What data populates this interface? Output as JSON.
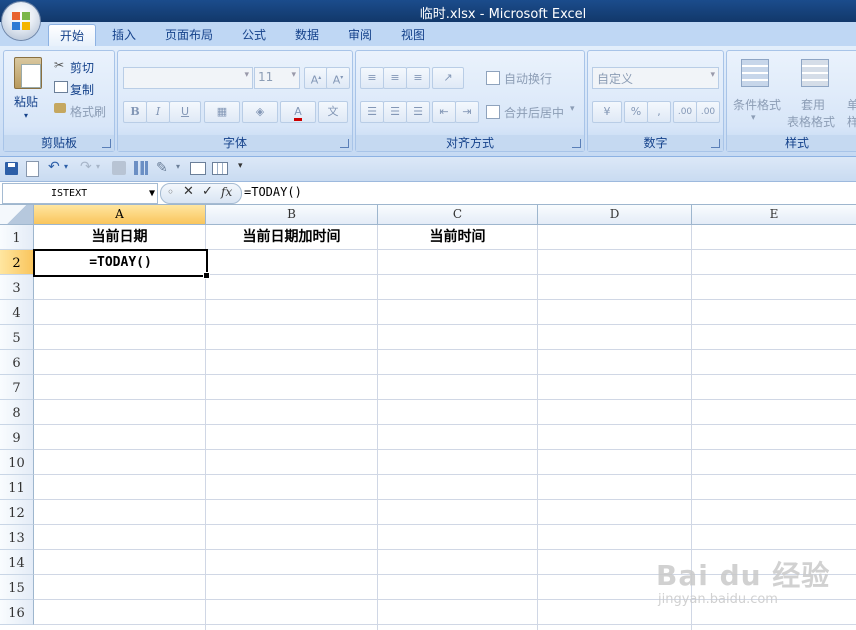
{
  "window": {
    "title": "临时.xlsx - Microsoft Excel"
  },
  "tabs": [
    {
      "label": "开始",
      "active": true
    },
    {
      "label": "插入"
    },
    {
      "label": "页面布局"
    },
    {
      "label": "公式"
    },
    {
      "label": "数据"
    },
    {
      "label": "审阅"
    },
    {
      "label": "视图"
    }
  ],
  "ribbon": {
    "clipboard": {
      "label": "剪贴板",
      "paste": "粘贴",
      "cut": "剪切",
      "copy": "复制",
      "format_painter": "格式刷"
    },
    "font": {
      "label": "字体",
      "font_name": "",
      "font_size": "11",
      "bold": "B",
      "italic": "I",
      "underline": "U"
    },
    "alignment": {
      "label": "对齐方式",
      "wrap_text": "自动换行",
      "merge_center": "合并后居中"
    },
    "number": {
      "label": "数字",
      "format": "自定义",
      "percent": "%",
      "comma": ",",
      "inc_decimal": ".00",
      "dec_decimal": ".00"
    },
    "styles": {
      "label": "样式",
      "conditional": "条件格式",
      "table_format_1": "套用",
      "table_format_2": "表格格式",
      "cell_styles_1": "单",
      "cell_styles_2": "样"
    }
  },
  "formula_bar": {
    "name_box": "ISTEXT",
    "fx": "fx",
    "formula": "=TODAY()"
  },
  "sheet": {
    "columns": [
      "A",
      "B",
      "C",
      "D",
      "E"
    ],
    "rows": [
      "1",
      "2",
      "3",
      "4",
      "5",
      "6",
      "7",
      "8",
      "9",
      "10",
      "11",
      "12",
      "13",
      "14",
      "15",
      "16"
    ],
    "cells": {
      "A1": "当前日期",
      "B1": "当前日期加时间",
      "C1": "当前时间",
      "A2": "=TODAY()"
    },
    "active_cell": "A2"
  },
  "watermark": {
    "brand": "Bai du 经验",
    "url": "jingyan.baidu.com"
  },
  "colors": {
    "ribbon_bg": "#d3e3f7",
    "selected_header": "#f9c55d",
    "accent": "#15428b"
  }
}
